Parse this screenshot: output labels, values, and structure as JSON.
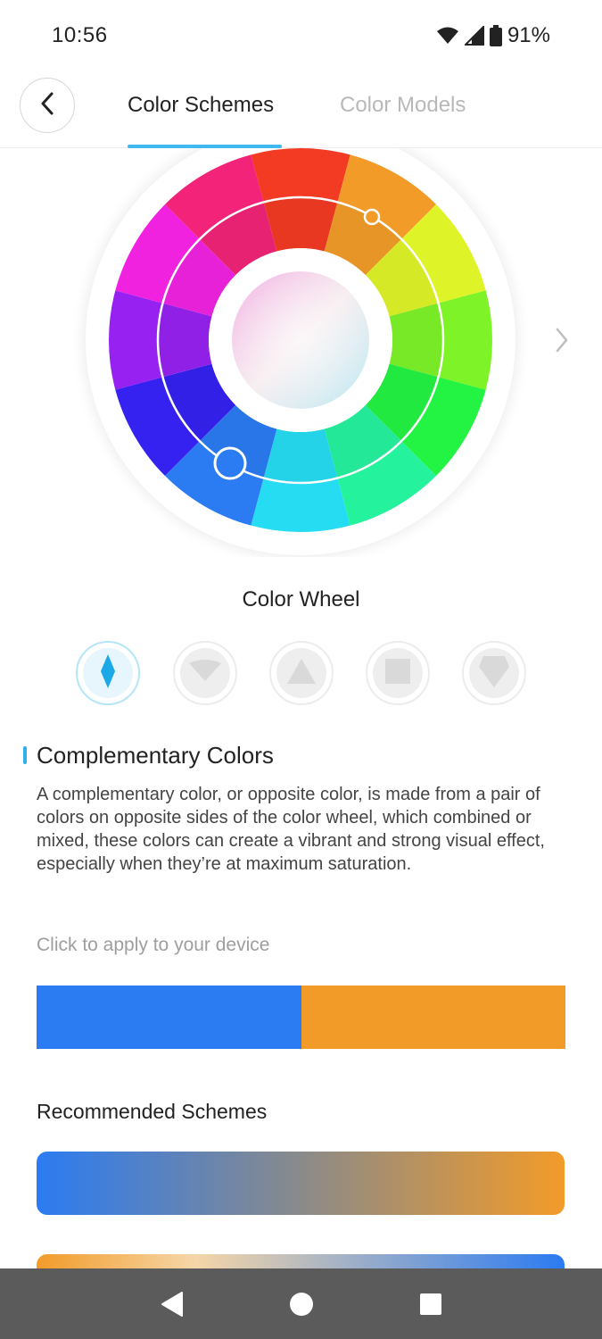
{
  "status": {
    "time": "10:56",
    "battery": "91%"
  },
  "header": {
    "tabs": [
      {
        "label": "Color Schemes",
        "active": true
      },
      {
        "label": "Color Models",
        "active": false
      }
    ]
  },
  "wheel": {
    "caption": "Color Wheel",
    "outer_ring": [
      "#f33a23",
      "#f29b29",
      "#dff329",
      "#7df328",
      "#23f342",
      "#24f29d",
      "#25dcf2",
      "#2b7bf2",
      "#3521f0",
      "#9621f0",
      "#f022e0",
      "#f22378"
    ],
    "inner_ring": [
      "#f33a23",
      "#f29b29",
      "#dff329",
      "#7df328",
      "#23f342",
      "#24f29d",
      "#25dcf2",
      "#2b7bf2",
      "#3521f0",
      "#9621f0",
      "#f022e0",
      "#f22378"
    ]
  },
  "scheme_types": [
    {
      "icon": "complementary-icon",
      "active": true
    },
    {
      "icon": "split-complementary-icon",
      "active": false
    },
    {
      "icon": "triadic-icon",
      "active": false
    },
    {
      "icon": "square-icon",
      "active": false
    },
    {
      "icon": "pentagon-icon",
      "active": false
    }
  ],
  "scheme": {
    "title": "Complementary Colors",
    "description": "A complementary color, or opposite color, is made from a pair of colors on opposite sides of the color wheel, which combined or mixed, these colors can create a vibrant and strong visual effect, especially when they’re at maximum saturation.",
    "apply_hint": "Click to apply to your device",
    "colors": [
      "#2b7bf2",
      "#f29b29"
    ]
  },
  "recommended": {
    "title": "Recommended Schemes",
    "bars": [
      {
        "from": "#2b7bf2",
        "to": "#f29b29"
      },
      {
        "from": "#f29b29",
        "to": "#2b7bf2"
      }
    ]
  }
}
